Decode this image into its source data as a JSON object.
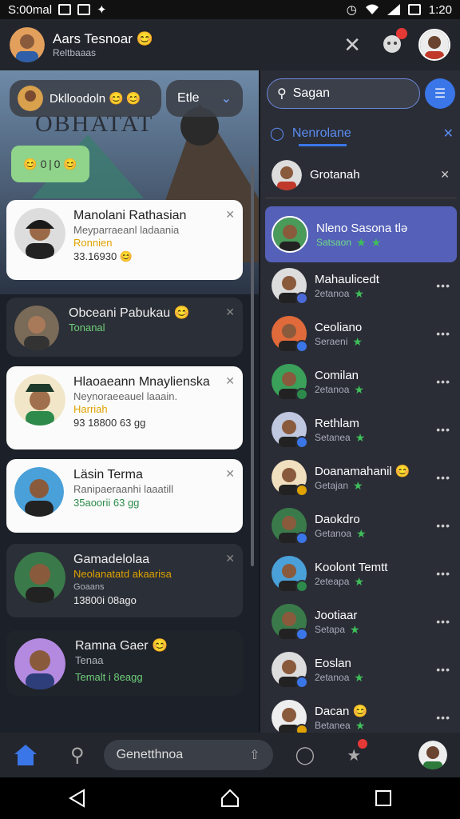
{
  "status": {
    "time": "S:00mal",
    "clock": "1:20"
  },
  "header": {
    "name": "Aars Tesnoar 😊",
    "sub": "Reltbaaas"
  },
  "left": {
    "profile_pill": "Dklloodoln 😊 😊",
    "filter_label": "Etle",
    "banner_text": "OBHATAT",
    "bubble_text": "😊 0 | 0 😊",
    "cards": [
      {
        "name": "Manolani Rathasian",
        "sub": "Meyparraeanl ladaania",
        "highlight": "Ronnien",
        "time": "33.16930",
        "emoji": "😊"
      },
      {
        "name": "Obceani Pabukau 😊",
        "sub": "Tonanal"
      },
      {
        "name": "Hlaoaeann Mnaylienska",
        "sub": "Neynoraeeauel laaain.",
        "highlight": "Harriah",
        "time": "93 18800 63 gg"
      },
      {
        "name": "Läsin Terma",
        "sub": "Ranipaeraanhi laaatill",
        "time": "35aoorii 63 gg"
      },
      {
        "name": "Gamadelolaa",
        "sub": "Neolanatatd akaarisa",
        "highlight": "Goaans",
        "time": "13800i 08ago"
      },
      {
        "name": "Ramna Gaer 😊",
        "sub": "Tenaa",
        "time": "Temalt i 8eagg"
      }
    ]
  },
  "right": {
    "search_placeholder": "Sagan",
    "tab_label": "Nenrolane",
    "pinned": "Grotanah",
    "items": [
      {
        "name": "Nleno Sasona tlə",
        "sub": "Satsaon"
      },
      {
        "name": "Mahaulicedt",
        "sub": "2etanoa"
      },
      {
        "name": "Ceoliano",
        "sub": "Seraeni"
      },
      {
        "name": "Comilan",
        "sub": "2etanoa"
      },
      {
        "name": "Rethlam",
        "sub": "Setanea"
      },
      {
        "name": "Doanamahanil 😊",
        "sub": "Getajan"
      },
      {
        "name": "Daokdro",
        "sub": "Getanoa"
      },
      {
        "name": "Koolont Temtt",
        "sub": "2eteapa"
      },
      {
        "name": "Jootiaar",
        "sub": "Setapa"
      },
      {
        "name": "Eoslan",
        "sub": "2etanoa"
      },
      {
        "name": "Dacan 😊",
        "sub": "Betanea"
      }
    ]
  },
  "bottom": {
    "search_label": "Genetthnoa"
  },
  "colors": {
    "accent": "#3a76e8",
    "highlight": "#5560b8",
    "green": "#3fbf5a",
    "red": "#e53935"
  }
}
